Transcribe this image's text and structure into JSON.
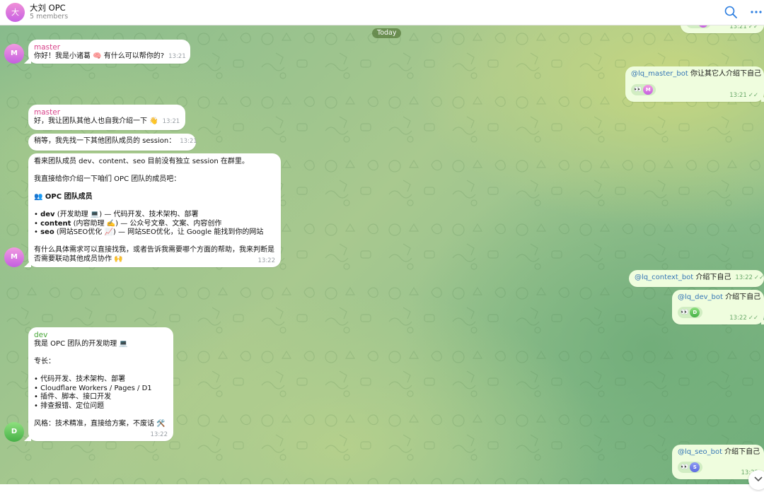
{
  "header": {
    "avatar_letter": "大",
    "title": "大刘 OPC",
    "subtitle": "5 members"
  },
  "date_label": "Today",
  "messages": {
    "top_out": {
      "time": "13:21",
      "reactor": "M"
    },
    "intro_request": {
      "mention": "@lq_master_bot",
      "text": " 你让其它人介绍下自己",
      "time": "13:21",
      "reactor": "M"
    },
    "master_greeting": {
      "sender": "master",
      "text": "你好！我是小诸葛 🧠 有什么可以帮你的?",
      "time": "13:21"
    },
    "master_team": {
      "sender": "master",
      "text": "好，我让团队其他人也自我介绍一下 👋",
      "time": "13:21"
    },
    "master_wait": {
      "text": "稍等，我先找一下其他团队成员的 session：",
      "time": "13:21"
    },
    "master_overview": {
      "line1": "看来团队成员 dev、content、seo 目前没有独立 session 在群里。",
      "line2": "我直接给你介绍一下咱们 OPC 团队的成员吧：",
      "heading": "👥 OPC 团队成员",
      "items": [
        {
          "name": "dev",
          "role": " (开发助理 💻) — 代码开发、技术架构、部署"
        },
        {
          "name": "content",
          "role": " (内容助理 ✍️) — 公众号文章、文案、内容创作"
        },
        {
          "name": "seo",
          "role": " (网站SEO优化 📈) — 网站SEO优化，让 Google 能找到你的网站"
        }
      ],
      "closing1": "有什么具体需求可以直接找我，或者告诉我需要哪个方面的帮助，我来判断是",
      "closing2": "否需要联动其他成员协作 🙌",
      "time": "13:22"
    },
    "context_out": {
      "mention": "@lq_context_bot",
      "text": " 介绍下自己",
      "time": "13:22"
    },
    "dev_out": {
      "mention": "@lq_dev_bot",
      "text": " 介绍下自己",
      "time": "13:22",
      "reactor": "D"
    },
    "dev_reply": {
      "sender": "dev",
      "intro": "我是 OPC 团队的开发助理 💻",
      "skills_title": "专长：",
      "skills": [
        "• 代码开发、技术架构、部署",
        "• Cloudflare Workers / Pages / D1",
        "• 插件、脚本、接口开发",
        "• 排查报错、定位问题"
      ],
      "style": "风格：技术精准，直接给方案，不废话 🛠️",
      "time": "13:22"
    },
    "seo_out": {
      "mention": "@lq_seo_bot",
      "text": " 介绍下自己",
      "time": "13:22",
      "reactor": "S"
    }
  },
  "avatars": {
    "master": "M",
    "dev": "D"
  },
  "colors": {
    "outgoing_bubble": "#effdde",
    "incoming_bubble": "#ffffff",
    "accent": "#3576b5",
    "master_name": "#d8438a",
    "dev_name": "#4aa83a"
  }
}
